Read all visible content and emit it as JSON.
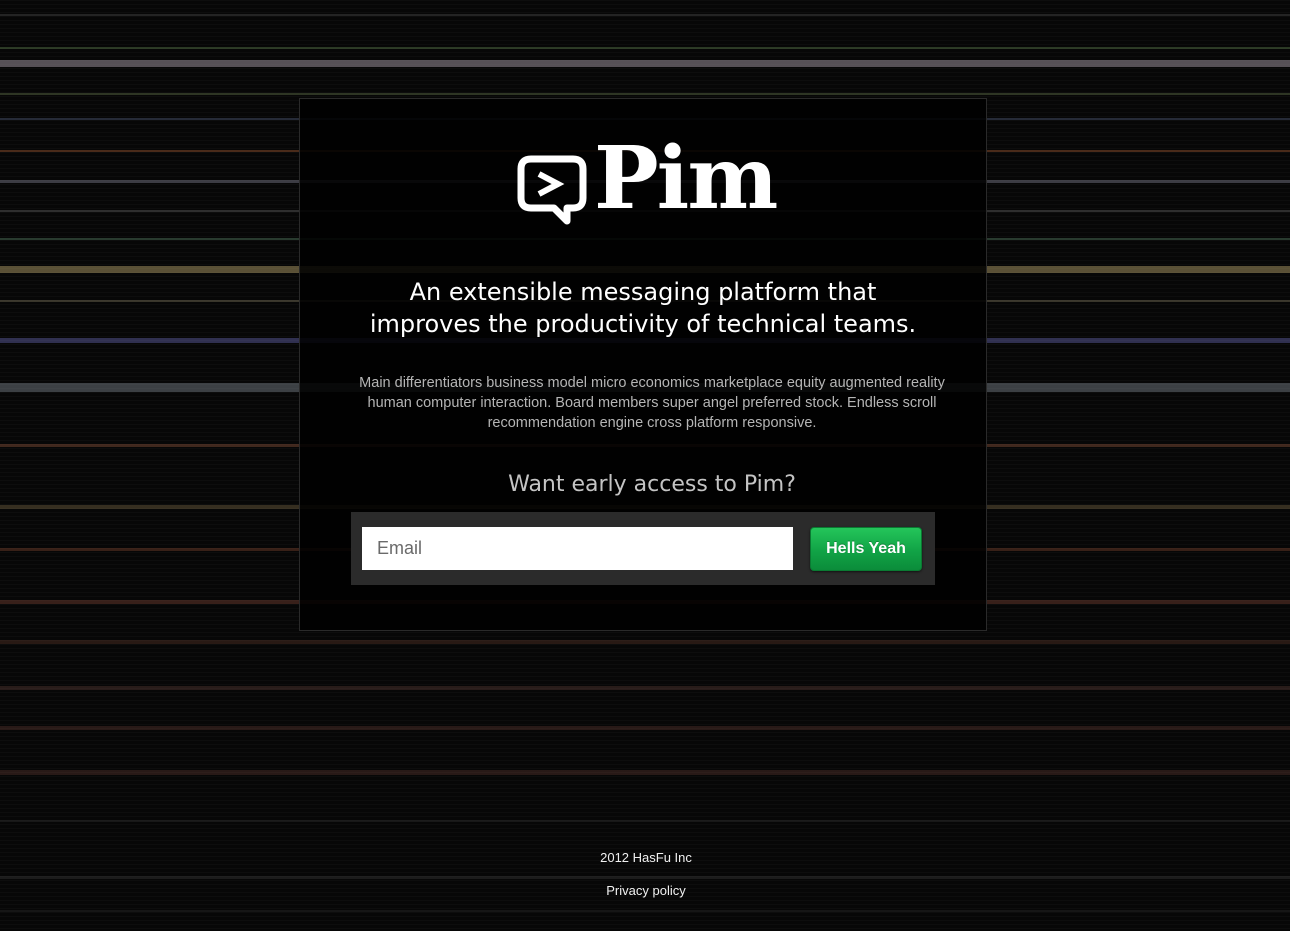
{
  "brand": {
    "name": "Pim",
    "logo_icon": "speech-bubble-prompt-icon"
  },
  "hero": {
    "headline_line1": "An extensible messaging platform that",
    "headline_line2": "improves the productivity of technical teams.",
    "description": "Main differentiators business model micro economics marketplace equity augmented reality human computer interaction. Board members super angel preferred stock. Endless scroll recommendation engine cross platform responsive."
  },
  "signup": {
    "heading": "Want early access to Pim?",
    "email_placeholder": "Email",
    "email_value": "",
    "submit_label": "Hells Yeah"
  },
  "footer": {
    "copyright": "2012 HasFu Inc",
    "privacy_label": "Privacy policy"
  },
  "colors": {
    "background": "#070707",
    "card": "#000000",
    "accent_button": "#11a346",
    "text_primary": "#ffffff",
    "text_secondary": "#b5b5b5"
  }
}
